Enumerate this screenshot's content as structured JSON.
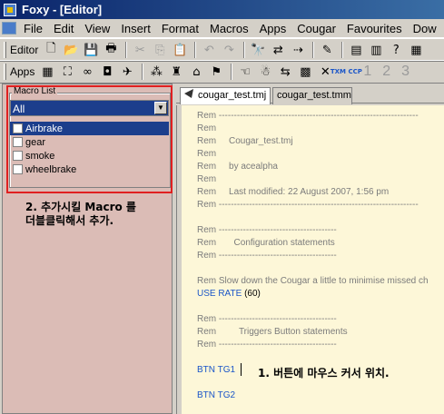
{
  "window": {
    "title": "Foxy - [Editor]"
  },
  "menu": [
    "File",
    "Edit",
    "View",
    "Insert",
    "Format",
    "Macros",
    "Apps",
    "Cougar",
    "Favourites",
    "Dow"
  ],
  "toolbar1": {
    "label": "Editor",
    "buttons": [
      "new-file-icon",
      "open-folder-icon",
      "save-icon",
      "print-icon",
      "cut-icon",
      "copy-icon",
      "paste-icon",
      "undo-icon",
      "redo-icon",
      "find-icon",
      "find-replace-icon",
      "find-next-icon",
      "bookmark-icon",
      "panel-1-icon",
      "panel-2-icon",
      "panel-help-icon",
      "panel-4-icon"
    ]
  },
  "toolbar2": {
    "label": "Apps",
    "buttons": [
      "app-1-icon",
      "app-2-icon",
      "app-3-icon",
      "app-4-icon",
      "app-5-icon",
      "app-6-icon",
      "app-7-icon",
      "app-8-icon",
      "app-9-icon",
      "app-10-icon",
      "app-11-icon",
      "app-12-icon",
      "app-13-icon",
      "app-14-icon"
    ],
    "numbers": [
      "1",
      "2",
      "3"
    ],
    "badge": "TXM CCP"
  },
  "macro_list": {
    "label": "Macro List",
    "filter": "All",
    "items": [
      {
        "label": "Airbrake",
        "selected": true
      },
      {
        "label": "gear",
        "selected": false
      },
      {
        "label": "smoke",
        "selected": false
      },
      {
        "label": "wheelbrake",
        "selected": false
      }
    ]
  },
  "note_left": [
    "2. 추가시킬 Macro 를",
    "더블클릭해서 추가."
  ],
  "tabs": [
    {
      "label": "cougar_test.tmj",
      "active": true
    },
    {
      "label": "cougar_test.tmm",
      "active": false
    }
  ],
  "editor_lines": [
    {
      "text": "Rem ------------------------------------------------------------------"
    },
    {
      "text": "Rem"
    },
    {
      "text": "Rem     Cougar_test.tmj"
    },
    {
      "text": "Rem"
    },
    {
      "text": "Rem     by acealpha"
    },
    {
      "text": "Rem"
    },
    {
      "text": "Rem     Last modified: 22 August 2007, 1:56 pm"
    },
    {
      "text": "Rem ------------------------------------------------------------------"
    },
    {
      "text": ""
    },
    {
      "text": "Rem ---------------------------------------"
    },
    {
      "text": "Rem       Configuration statements"
    },
    {
      "text": "Rem ---------------------------------------"
    },
    {
      "text": ""
    },
    {
      "text": "Rem Slow down the Cougar a little to minimise missed ch"
    },
    {
      "kw": "USE RATE",
      "pl": "(60)"
    },
    {
      "text": ""
    },
    {
      "text": "Rem ---------------------------------------"
    },
    {
      "text": "Rem         Triggers Button statements"
    },
    {
      "text": "Rem ---------------------------------------"
    },
    {
      "text": ""
    },
    {
      "kw": "BTN TG1",
      "pl": ""
    },
    {
      "text": ""
    },
    {
      "kw": "BTN TG2",
      "pl": ""
    }
  ],
  "note_right": "1. 버튼에 마우스 커서 위치."
}
